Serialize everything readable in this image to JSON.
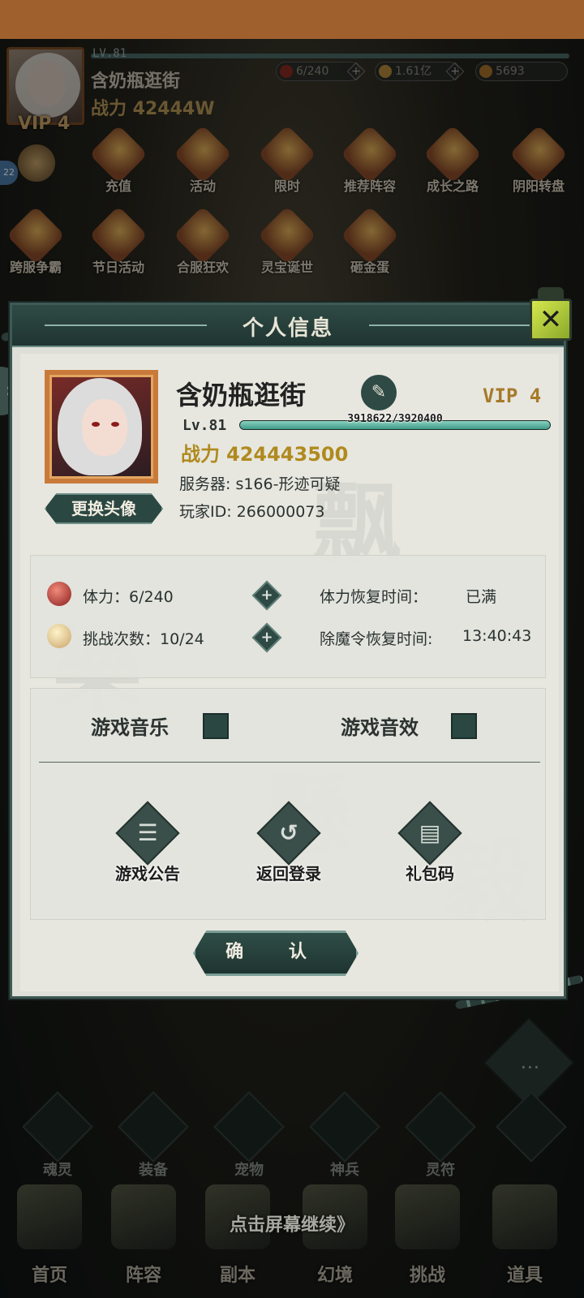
{
  "hud": {
    "level": "LV.81",
    "name": "含奶瓶逛街",
    "power": "战力 42444W",
    "vip": "VIP 4",
    "resources": [
      {
        "icon": "stamina-orb-icon",
        "value": "6/240"
      },
      {
        "icon": "coin-icon",
        "value": "1.61亿"
      },
      {
        "icon": "ingot-icon",
        "value": "5693"
      }
    ],
    "side_badge": "22"
  },
  "menu_row1": [
    "充值",
    "活动",
    "限时",
    "推荐阵容",
    "成长之路",
    "阴阳转盘"
  ],
  "menu_row2": [
    "跨服争霸",
    "节日活动",
    "合服狂欢",
    "灵宝诞世",
    "砸金蛋"
  ],
  "modal": {
    "title": "个人信息",
    "close_icon": "close-lantern-icon",
    "profile": {
      "name": "含奶瓶逛街",
      "vip": "VIP 4",
      "level": "Lv.81",
      "exp_text": "3918622/3920400",
      "exp_fraction": 0.9995,
      "power_label": "战力",
      "power_value": "424443500",
      "server": "服务器: s166-形迹可疑",
      "player_id": "玩家ID: 266000073",
      "change_avatar": "更换头像",
      "edit_icon": "pencil-icon"
    },
    "stats": {
      "stamina": "体力：6/240",
      "stamina_recover_label": "体力恢复时间：",
      "stamina_recover_value": "已满",
      "challenges": "挑战次数：10/24",
      "seal_recover_label": "除魔令恢复时间:",
      "seal_recover_value": "13:40:43"
    },
    "settings": {
      "music": "游戏音乐",
      "sfx": "游戏音效"
    },
    "actions": [
      {
        "label": "游戏公告",
        "icon": "notice-icon"
      },
      {
        "label": "返回登录",
        "icon": "return-icon"
      },
      {
        "label": "礼包码",
        "icon": "gift-code-icon"
      }
    ],
    "confirm": "确 认"
  },
  "subnav": [
    "魂灵",
    "装备",
    "宠物",
    "神兵",
    "灵符",
    "+"
  ],
  "mainnav": [
    "首页",
    "阵容",
    "副本",
    "幻境",
    "挑战",
    "道具"
  ],
  "tap_continue": "点击屏幕继续》",
  "colors": {
    "status_bar": "#a0602e",
    "panel_dark": "#2f4a45",
    "gold": "#b08a1e",
    "modal_bg": "#e7e7e0"
  }
}
